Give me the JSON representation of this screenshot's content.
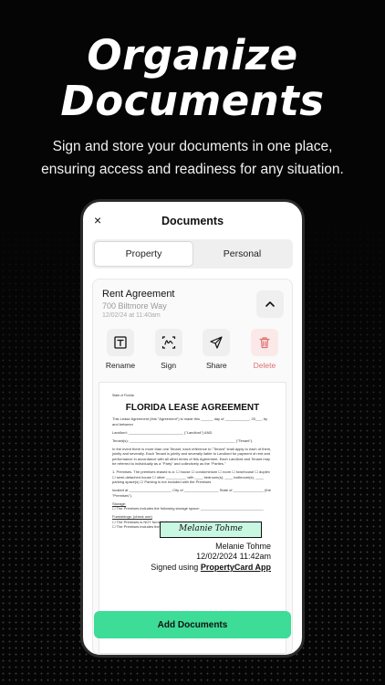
{
  "hero": {
    "title_line1": "Organize",
    "title_line2": "Documents",
    "subtitle_line1": "Sign and store your documents in one place,",
    "subtitle_line2": "ensuring access and readiness for any situation."
  },
  "screen": {
    "title": "Documents",
    "close_icon": "×"
  },
  "tabs": [
    {
      "label": "Property",
      "active": true
    },
    {
      "label": "Personal",
      "active": false
    }
  ],
  "document": {
    "title": "Rent Agreement",
    "address": "700 Biltmore Way",
    "date": "12/02/24 at 11:40am"
  },
  "actions": {
    "rename": "Rename",
    "sign": "Sign",
    "share": "Share",
    "delete": "Delete"
  },
  "preview": {
    "state": "State of Florida",
    "lease_title": "FLORIDA LEASE AGREEMENT",
    "line1": "This Lease Agreement (this \"Agreement\") is made this ______ day of ____________, 20___, by and between",
    "landlord": "Landlord: ___________________________ (\"Landlord\") AND",
    "tenants": "Tenant(s): ____________________________________________________ (\"Tenant\").",
    "para": "In the event there is more than one Tenant, each reference to \"Tenant\" shall apply to each of them, jointly and severally. Each Tenant is jointly and severally liable to Landlord for payment of rent and performance in accordance with all other terms of this Agreement. Each Landlord and Tenant may be referred to individually as a \"Party\" and collectively as the \"Parties.\"",
    "premises": "1. Premises. The premises leased is a: ☐ house ☐ condominium ☐ room ☐ townhouse ☐ duplex ☐ semi-detached house ☐ other __________ with ____ bedroom(s), ____ bathroom(s), ____ parking space(s) ☐ Parking is not included with the Premises",
    "located": "located at _____________________ City of _________________ State of _______________ (the \"Premises\").",
    "storage_head": "Storage:",
    "storage": "☐ The Premises includes the following storage space: _______________________________",
    "furnishings_head": "Furnishings: (check one)",
    "furnish1": "☐ The Premises is NOT furnished.",
    "furnish2": "☐ The Premises includes the following",
    "signature": "Melanie Tohme",
    "signer_name": "Melanie Tohme",
    "signed_date": "12/02/2024 11:42am",
    "signed_using": "Signed using",
    "brand": "PropertyCard App"
  },
  "buttons": {
    "add": "Add Documents"
  },
  "colors": {
    "accent": "#3ddc97",
    "delete": "#e07070",
    "signature_bg": "#c8f7e2"
  }
}
